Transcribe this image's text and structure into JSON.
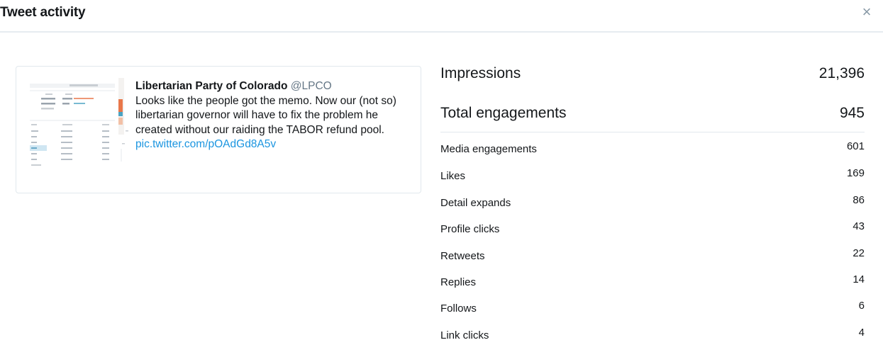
{
  "header": {
    "title": "Tweet activity",
    "close_symbol": "×"
  },
  "tweet": {
    "author_name": "Libertarian Party of Colorado",
    "author_handle": "@LPCO",
    "text": "Looks like the people got the memo. Now our (not so) libertarian governor will have to fix the problem he created without our raiding the TABOR refund pool.",
    "link": "pic.twitter.com/pOAdGd8A5v"
  },
  "stats": {
    "impressions": {
      "label": "Impressions",
      "value": "21,396"
    },
    "total_engagements": {
      "label": "Total engagements",
      "value": "945"
    },
    "breakdown": [
      {
        "label": "Media engagements",
        "value": "601"
      },
      {
        "label": "Likes",
        "value": "169"
      },
      {
        "label": "Detail expands",
        "value": "86"
      },
      {
        "label": "Profile clicks",
        "value": "43"
      },
      {
        "label": "Retweets",
        "value": "22"
      },
      {
        "label": "Replies",
        "value": "14"
      },
      {
        "label": "Follows",
        "value": "6"
      },
      {
        "label": "Link clicks",
        "value": "4"
      }
    ]
  },
  "colors": {
    "accent_link": "#1b95e0",
    "handle_gray": "#657786",
    "divider": "#e1e8ed",
    "media_orange": "#e8774a",
    "media_teal": "#4ba3c3"
  }
}
